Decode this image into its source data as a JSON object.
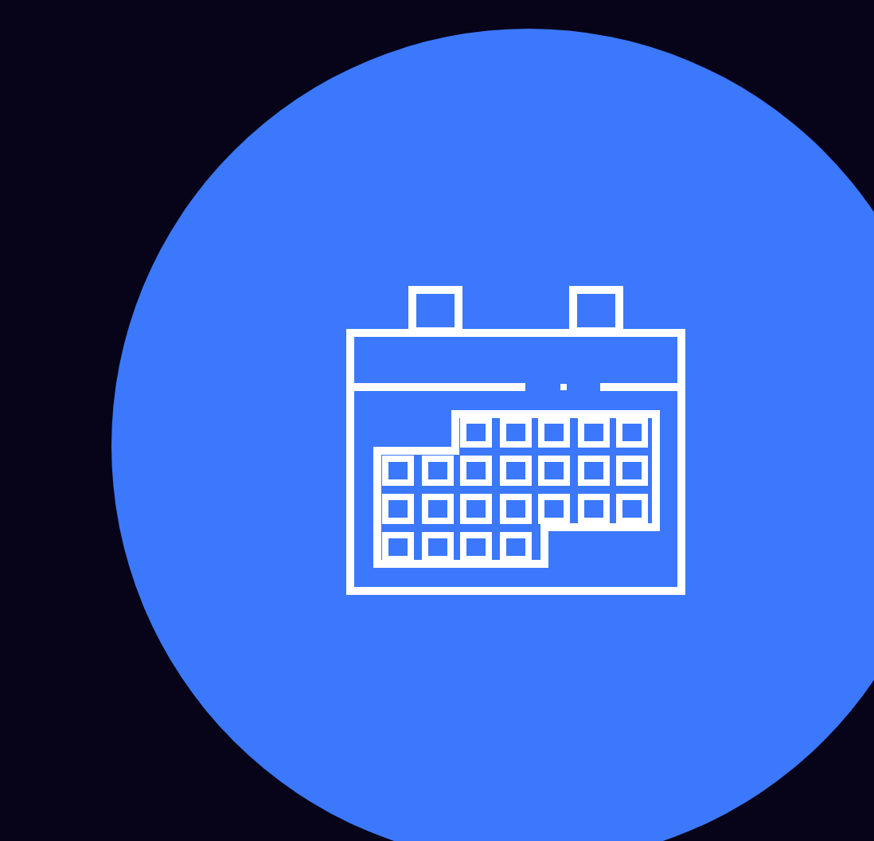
{
  "badge": {
    "kind": "calendar"
  }
}
